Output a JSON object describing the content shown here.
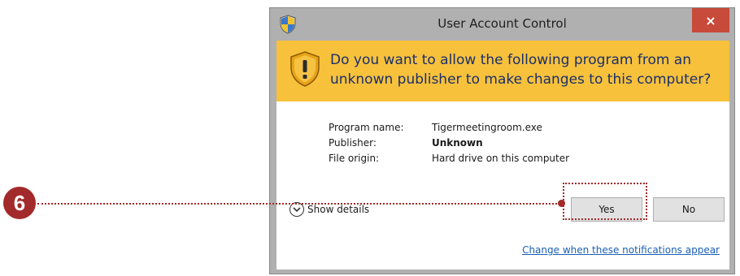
{
  "callout": {
    "step_number": "6",
    "color": "#a32a2a"
  },
  "window": {
    "title": "User Account Control",
    "close_glyph": "×"
  },
  "banner": {
    "question": "Do you want to allow the following program from an unknown publisher to make changes to this computer?",
    "color": "#f7c13b"
  },
  "info": {
    "program_name_label": "Program name:",
    "program_name_value": "Tigermeetingroom.exe",
    "publisher_label": "Publisher:",
    "publisher_value": "Unknown",
    "file_origin_label": "File origin:",
    "file_origin_value": "Hard drive on this computer"
  },
  "details": {
    "label": "Show details"
  },
  "buttons": {
    "yes": "Yes",
    "no": "No"
  },
  "footer": {
    "link": "Change when these notifications appear"
  }
}
